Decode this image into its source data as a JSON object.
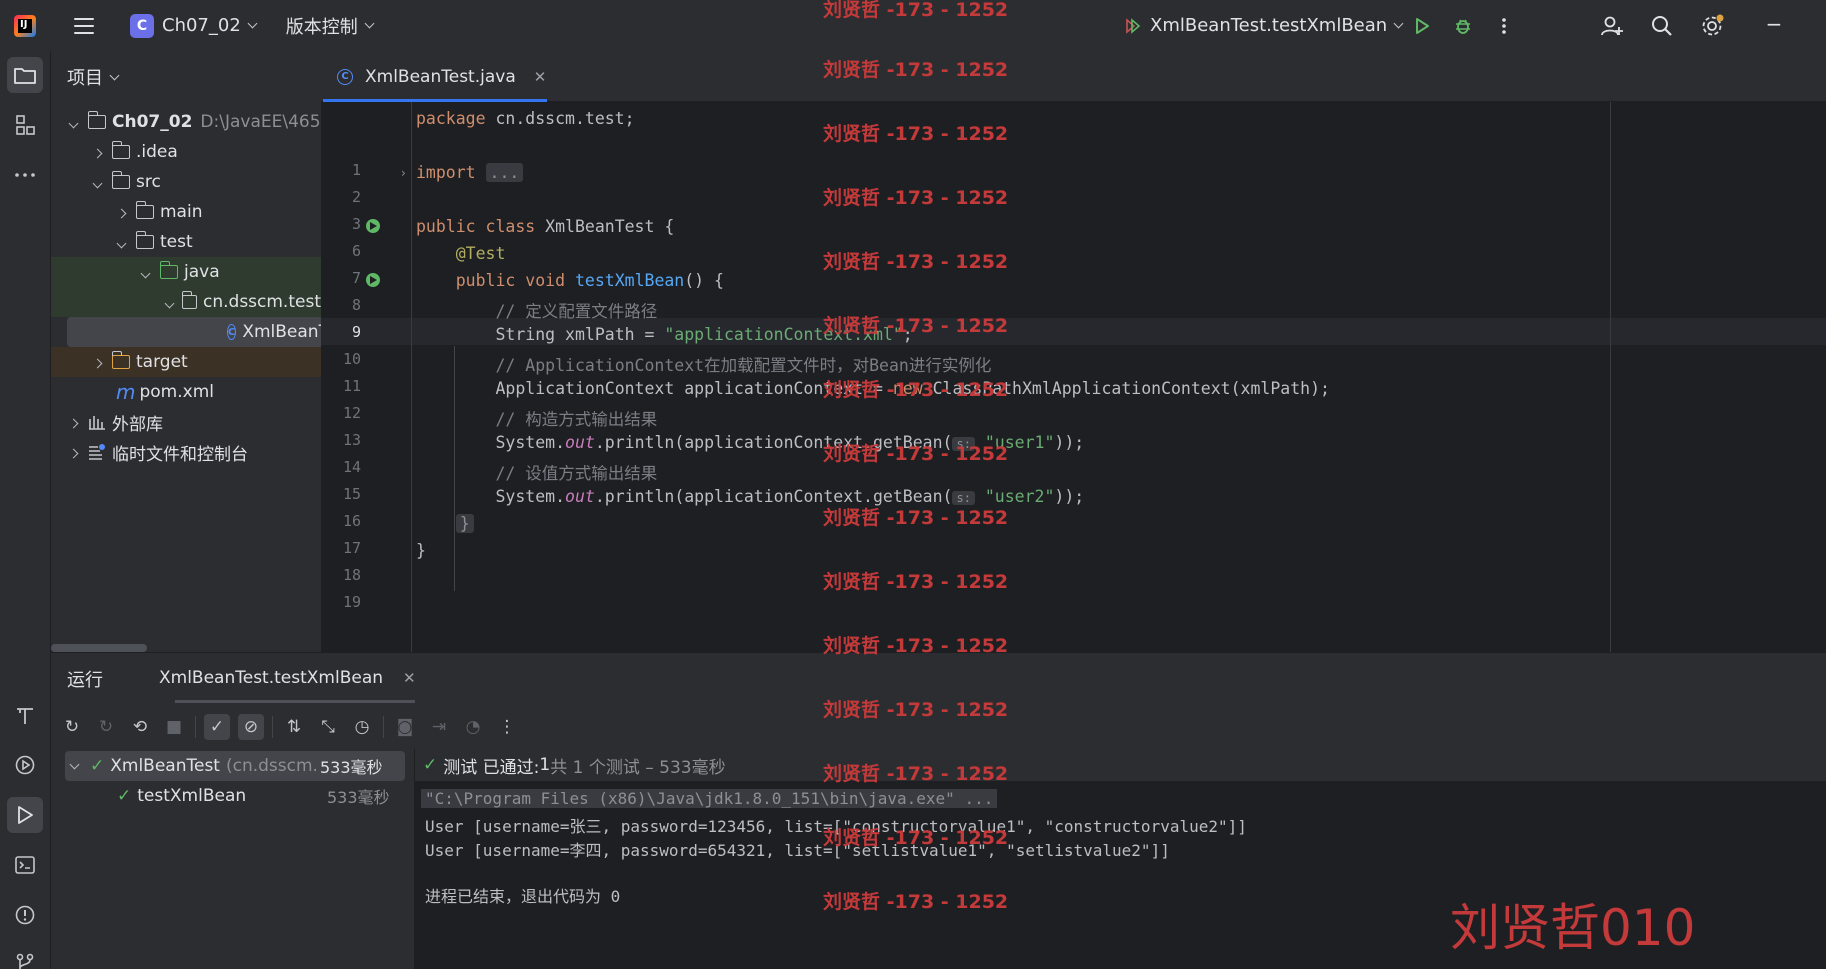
{
  "titlebar": {
    "project_badge": "C",
    "project_name": "Ch07_02",
    "vcs_label": "版本控制",
    "run_config": "XmlBeanTest.testXmlBean",
    "minimize": "−"
  },
  "project_panel": {
    "title": "项目",
    "tree": [
      {
        "label": "Ch07_02",
        "extra": "D:\\JavaEE\\465"
      },
      {
        "label": ".idea"
      },
      {
        "label": "src"
      },
      {
        "label": "main"
      },
      {
        "label": "test"
      },
      {
        "label": "java"
      },
      {
        "label": "cn.dsscm.test"
      },
      {
        "label": "XmlBeanTest"
      },
      {
        "label": "target"
      },
      {
        "label": "pom.xml"
      },
      {
        "label": "外部库"
      },
      {
        "label": "临时文件和控制台"
      }
    ]
  },
  "editor": {
    "tab": "XmlBeanTest.java",
    "line_numbers": [
      "1",
      "2",
      "3",
      "6",
      "7",
      "8",
      "9",
      "10",
      "11",
      "12",
      "13",
      "14",
      "15",
      "16",
      "17",
      "18",
      "19"
    ],
    "code": {
      "l1_kw": "package",
      "l1_rest": " cn.dsscm.test;",
      "l3_kw": "import",
      "l3_fold": "...",
      "l7_kw": "public class",
      "l7_rest": " XmlBeanTest {",
      "l8": "@Test",
      "l9_kw": "public void",
      "l9_fn": "testXmlBean",
      "l9_rest": "() {",
      "l10": "// 定义配置文件路径",
      "l11_pre": "String xmlPath = ",
      "l11_str": "\"applicationContext.xml\"",
      "l11_post": ";",
      "l12": "// ApplicationContext在加载配置文件时，对Bean进行实例化",
      "l13_pre": "ApplicationContext applicationContext = ",
      "l13_kw": "new",
      "l13_post": " ClassPathXmlApplicationContext(xmlPath);",
      "l14": "// 构造方式输出结果",
      "l15_pre": "System.",
      "l15_fld": "out",
      "l15_mid": ".println(applicationContext.getBean(",
      "l15_hint": "s:",
      "l15_str": "\"user1\"",
      "l15_post": "));",
      "l16": "// 设值方式输出结果",
      "l17_pre": "System.",
      "l17_fld": "out",
      "l17_mid": ".println(applicationContext.getBean(",
      "l17_hint": "s:",
      "l17_str": "\"user2\"",
      "l17_post": "));",
      "l18": "}",
      "l19": "}"
    }
  },
  "watermark": {
    "text": "刘贤哲 -173 - 1252",
    "big": "刘贤哲010"
  },
  "run_panel": {
    "tab_label": "运行",
    "run_tab": "XmlBeanTest.testXmlBean",
    "tests": [
      {
        "name": "XmlBeanTest",
        "pkg": "(cn.dsscm.t",
        "time": "533毫秒"
      },
      {
        "name": "testXmlBean",
        "time": "533毫秒"
      }
    ],
    "summary_prefix": "测试 已通过: ",
    "summary_count": "1",
    "summary_suffix": "共 1 个测试 – 533毫秒",
    "console": [
      "\"C:\\Program Files (x86)\\Java\\jdk1.8.0_151\\bin\\java.exe\" ...",
      "User [username=张三, password=123456, list=[\"constructorvalue1\", \"constructorvalue2\"]]",
      "User [username=李四, password=654321, list=[\"setlistvalue1\", \"setlistvalue2\"]]",
      "进程已结束，退出代码为 0"
    ]
  }
}
